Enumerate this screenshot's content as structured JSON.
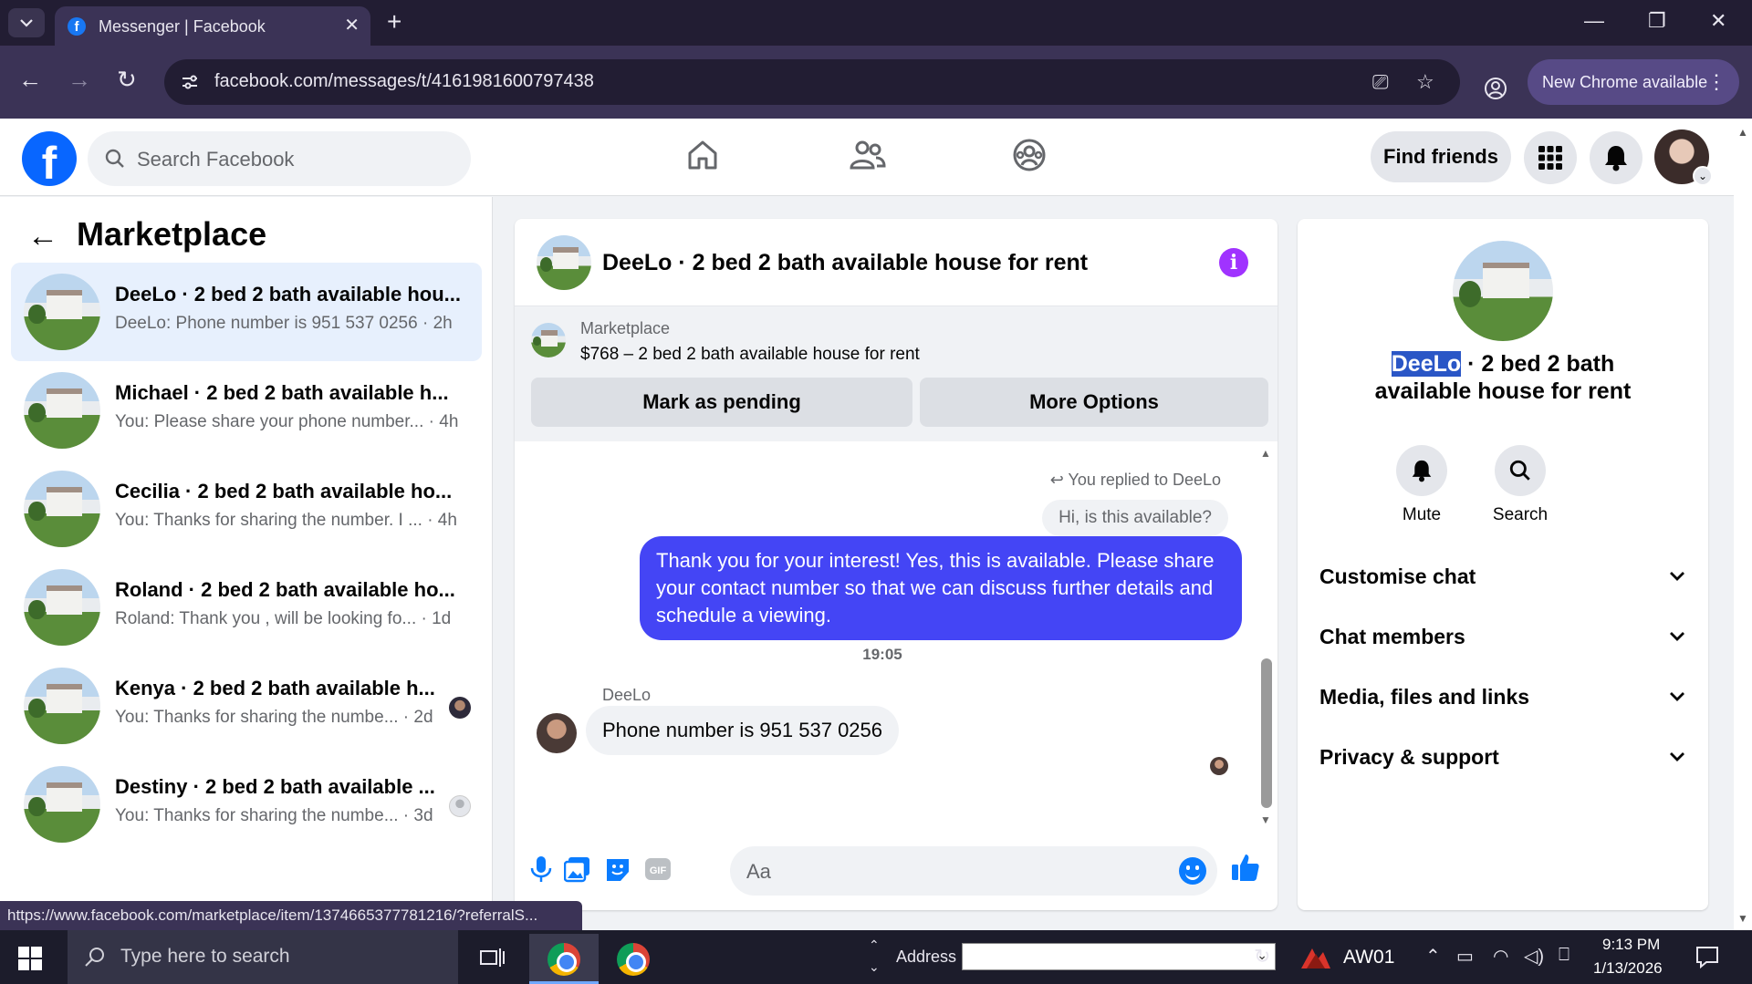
{
  "browser": {
    "tab_title": "Messenger | Facebook",
    "url": "facebook.com/messages/t/4161981600797438",
    "new_chrome_label": "New Chrome available",
    "status_url": "https://www.facebook.com/marketplace/item/1374665377781216/?referralS..."
  },
  "fb_header": {
    "search_placeholder": "Search Facebook",
    "find_friends_label": "Find friends"
  },
  "sidebar": {
    "title": "Marketplace",
    "conversations": [
      {
        "name": "DeeLo · 2 bed 2 bath available hou...",
        "preview": "DeeLo: Phone number is 951 537 0256 · 2h"
      },
      {
        "name": "Michael · 2 bed 2 bath available h...",
        "preview": "You: Please share your phone number... · 4h"
      },
      {
        "name": "Cecilia · 2 bed 2 bath available ho...",
        "preview": "You: Thanks for sharing the number. I ... · 4h"
      },
      {
        "name": "Roland · 2 bed 2 bath available ho...",
        "preview": "Roland: Thank you , will be looking fo... · 1d"
      },
      {
        "name": "Kenya · 2 bed 2 bath available h...",
        "preview": "You: Thanks for sharing the numbe... · 2d"
      },
      {
        "name": "Destiny · 2 bed 2 bath available ...",
        "preview": "You: Thanks for sharing the numbe... · 3d"
      }
    ]
  },
  "chat": {
    "title": "DeeLo · 2 bed 2 bath available house for rent",
    "marketplace_label": "Marketplace",
    "listing": "$768 – 2 bed 2 bath available house for rent",
    "mark_pending_label": "Mark as pending",
    "more_options_label": "More Options",
    "replied_to": "You replied to DeeLo",
    "quoted_message": "Hi, is this available?",
    "outgoing_message": "Thank you for your interest! Yes, this is available. Please share your contact number so that we can discuss further details and schedule a viewing.",
    "timestamp": "19:05",
    "sender_name": "DeeLo",
    "incoming_message": "Phone number is 951 537 0256",
    "composer_placeholder": "Aa"
  },
  "info_panel": {
    "title_highlight": "DeeLo",
    "title_rest": " · 2 bed 2 bath available house for rent",
    "mute_label": "Mute",
    "search_label": "Search",
    "sections": [
      "Customise chat",
      "Chat members",
      "Media, files and links",
      "Privacy & support"
    ]
  },
  "taskbar": {
    "search_placeholder": "Type here to search",
    "address_label": "Address",
    "aw_label": "AW01",
    "time": "9:13 PM",
    "date": "1/13/2026"
  },
  "colors": {
    "fb_blue": "#0866ff",
    "outgoing_bubble": "#4445f5",
    "info_icon": "#a033ff",
    "active_conversation": "#e7f0fd"
  }
}
